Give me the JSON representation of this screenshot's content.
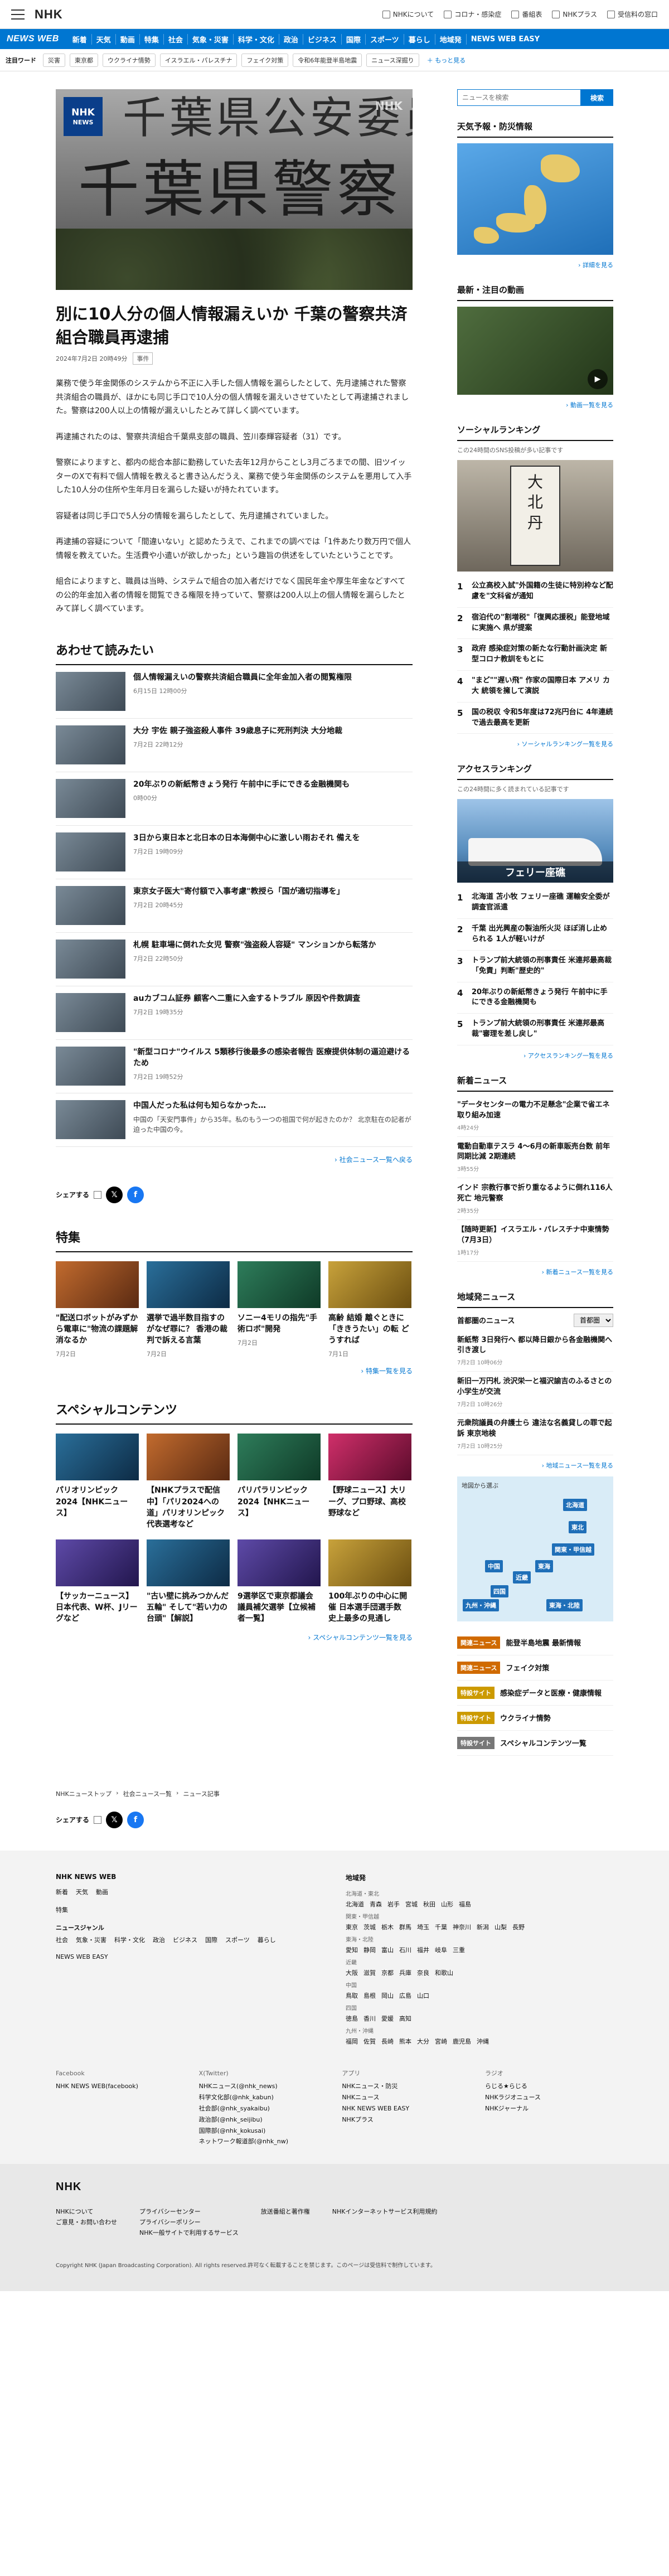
{
  "header": {
    "logo": "NHK",
    "links": [
      "NHKについて",
      "コロナ・感染症",
      "番組表",
      "NHKプラス",
      "受信料の窓口"
    ]
  },
  "nav": {
    "brand": "NEWS WEB",
    "items": [
      "新着",
      "天気",
      "動画",
      "特集",
      "社会",
      "気象・災害",
      "科学・文化",
      "政治",
      "ビジネス",
      "国際",
      "スポーツ",
      "暮らし",
      "地域発",
      "NEWS WEB EASY"
    ]
  },
  "keywords": {
    "label": "注目ワード",
    "tags": [
      "災害",
      "東京都",
      "ウクライナ情勢",
      "イスラエル・パレスチナ",
      "フェイク対策",
      "令和6年能登半島地震",
      "ニュース深掘り"
    ],
    "more": "もっと見る"
  },
  "article": {
    "hero_plate_top": "千葉県公安委員会",
    "hero_plate_bottom": "千葉県警察",
    "badge_line1": "NHK",
    "badge_line2": "NEWS",
    "watermark": "NHK",
    "title": "別に10人分の個人情報漏えいか 千葉の警察共済組合職員再逮捕",
    "date": "2024年7月2日 20時49分",
    "category": "事件",
    "paragraphs": [
      "業務で使う年金関係のシステムから不正に入手した個人情報を漏らしたとして、先月逮捕された警察共済組合の職員が、ほかにも同じ手口で10人分の個人情報を漏えいさせていたとして再逮捕されました。警察は200人以上の情報が漏えいしたとみて詳しく調べています。",
      "再逮捕されたのは、警察共済組合千葉県支部の職員、笠川泰輝容疑者（31）です。",
      "警察によりますと、都内の総合本部に勤務していた去年12月からことし3月ごろまでの間、旧ツイッターのXで有料で個人情報を教えると書き込んだうえ、業務で使う年金関係のシステムを悪用して入手した10人分の住所や生年月日を漏らした疑いが持たれています。",
      "容疑者は同じ手口で5人分の情報を漏らしたとして、先月逮捕されていました。",
      "再逮捕の容疑について「間違いない」と認めたうえで、これまでの調べでは「1件あたり数万円で個人情報を教えていた。生活費や小遣いが欲しかった」という趣旨の供述をしていたということです。",
      "組合によりますと、職員は当時、システムで組合の加入者だけでなく国民年金や厚生年金などすべての公的年金加入者の情報を閲覧できる権限を持っていて、警察は200人以上の個人情報を漏らしたとみて詳しく調べています。"
    ]
  },
  "related": {
    "heading": "あわせて読みたい",
    "items": [
      {
        "title": "個人情報漏えいの警察共済組合職員に全年金加入者の閲覧権限",
        "date": "6月15日 12時00分",
        "thumb": "#4a5560",
        "text": ""
      },
      {
        "title": "大分 宇佐 親子強盗殺人事件 39歳息子に死刑判決 大分地裁",
        "date": "7月2日 22時12分",
        "thumb": "#5a6a52",
        "text": ""
      },
      {
        "title": "20年ぶりの新紙幣きょう発行 午前中に手にできる金融機関も",
        "date": "0時00分",
        "thumb": "#2f5f9e",
        "text": ""
      },
      {
        "title": "3日から東日本と北日本の日本海側中心に激しい雨おそれ 備えを",
        "date": "7月2日 19時09分",
        "thumb": "#6b7b8c",
        "text": ""
      },
      {
        "title": "東京女子医大\"寄付額で入事考慮\"教授ら「国が適切指導を」",
        "date": "7月2日 20時45分",
        "thumb": "#7b6a5a",
        "text": ""
      },
      {
        "title": "札幌 駐車場に倒れた女児 警察\"強盗殺人容疑\" マンションから転落か",
        "date": "7月2日 22時50分",
        "thumb": "#556677",
        "text": ""
      },
      {
        "title": "auカブコム証券 顧客へ二重に入金するトラブル 原因や件数調査",
        "date": "7月2日 19時35分",
        "thumb": "#e35b1b",
        "text": ""
      },
      {
        "title": "\"新型コロナ\"ウイルス 5類移行後最多の感染者報告 医療提供体制の逼迫避けるため",
        "date": "7月2日 19時52分",
        "thumb": "#3e5a3a",
        "text": ""
      },
      {
        "title": "中国人だった私は何も知らなかった…",
        "date": "",
        "thumb": "#8a6a55",
        "text": "中国の「天安門事件」から35年。私のもう一つの祖国で何が起きたのか？ 北京駐在の記者が迫った中国の今。"
      }
    ],
    "more": "社会ニュース一覧へ戻る"
  },
  "share": {
    "label": "シェアする"
  },
  "features": {
    "heading": "特集",
    "items": [
      {
        "title": "\"配送ロボットがみずから電車に\"物流の課題解消なるか",
        "date": "7月2日"
      },
      {
        "title": "選挙で過半数目指すのがなぜ罪に？ 香港の裁判で訴える言葉",
        "date": "7月2日"
      },
      {
        "title": "ソニー4モリの指先\"手術ロボ\"開発",
        "date": "7月2日"
      },
      {
        "title": "高齢 結婚 離ぐときに「ききうたい」の転 どうすれば",
        "date": "7月1日"
      }
    ],
    "more": "特集一覧を見る"
  },
  "special": {
    "heading": "スペシャルコンテンツ",
    "items": [
      {
        "title": "パリオリンピック2024【NHKニュース】"
      },
      {
        "title": "【NHKプラスで配信中】「パリ2024への道」パリオリンピック代表選考など"
      },
      {
        "title": "パリパラリンピック2024【NHKニュース】"
      },
      {
        "title": "【野球ニュース】大リーグ、プロ野球、高校野球など"
      },
      {
        "title": "【サッカーニュース】日本代表、W杯、Jリーグなど"
      },
      {
        "title": "\"古い壁に挑みつかんだ五輪\" そして\"若い力の台頭\"【解説】"
      },
      {
        "title": "9選挙区で東京都議会議員補欠選挙【立候補者一覧】"
      },
      {
        "title": "100年ぶりの中心に開催 日本選手団選手数 史上最多の見通し"
      }
    ],
    "more": "スペシャルコンテンツ一覧を見る"
  },
  "sidebar": {
    "search_placeholder": "ニュースを検索",
    "search_button": "検索",
    "weather_heading": "天気予報・防災情報",
    "weather_more": "詳細を見る",
    "video_heading": "最新・注目の動画",
    "video_more": "動画一覧を見る",
    "social_heading": "ソーシャルランキング",
    "social_desc": "この24時間のSNS投稿が多い記事です",
    "social_items": [
      "公立高校入試\"外国籍の生徒に特別枠など配慮を\"文科省が通知",
      "宿泊代の\"割増税\"「復興応援税」能登地域に実施へ 県が提案",
      "政府 感染症対策の新たな行動計画決定 新型コロナ教訓をもとに",
      "\"まど\"\"遅い飛\" 作家の国際日本 アメリ カ大 統領を擁して演説",
      "国の税収 令和5年度は72兆円台に 4年連続で過去最高を更新"
    ],
    "social_more": "ソーシャルランキング一覧を見る",
    "access_heading": "アクセスランキング",
    "access_desc": "この24時間に多く読まれている記事です",
    "access_caption": "フェリー座礁",
    "access_items": [
      "北海道 苫小牧 フェリー座礁 運輸安全委が調査官派遣",
      "千葉 出光興産の製油所火災 ほぼ消し止められる 1人が軽いけが",
      "トランプ前大統領の刑事責任 米連邦最高裁「免責」判断\"歴史的\"",
      "20年ぶりの新紙幣きょう発行 午前中に手にできる金融機関も",
      "トランプ前大統領の刑事責任 米連邦最高裁\"審理を差し戻し\""
    ],
    "access_more": "アクセスランキング一覧を見る",
    "new_heading": "新着ニュース",
    "new_items": [
      {
        "title": "\"データセンターの電力不足懸念\"企業で省エネ取り組み加速",
        "date": "4時24分"
      },
      {
        "title": "電動自動車テスラ 4～6月の新車販売台数 前年同期比減 2期連続",
        "date": "3時55分"
      },
      {
        "title": "インド 宗教行事で折り重なるように倒れ116人死亡 地元警察",
        "date": "2時35分"
      },
      {
        "title": "【随時更新】イスラエル・パレスチナ中東情勢（7月3日）",
        "date": "1時17分"
      }
    ],
    "new_more": "新着ニュース一覧を見る",
    "local_heading": "地域発ニュース",
    "local_select_label": "首都圏のニュース",
    "local_select_value": "首都圏",
    "local_items": [
      {
        "title": "新紙幣 3日発行へ 都以降日銀から各金融機関へ引き渡し",
        "date": "7月2日 10時06分"
      },
      {
        "title": "新旧一万円札 渋沢栄一と福沢諭吉のふるさとの小学生が交流",
        "date": "7月2日 10時26分"
      },
      {
        "title": "元衆院議員の弁護士ら 違法な名義貸しの罪で起訴 東京地検",
        "date": "7月2日 10時25分"
      }
    ],
    "local_more": "地域ニュース一覧を見る",
    "map_title": "地図から選ぶ",
    "regions": [
      "北海道",
      "東北",
      "関東・甲信越",
      "東海",
      "近畿",
      "中国",
      "四国",
      "九州・沖縄",
      "東海・北陸"
    ],
    "banners": [
      {
        "tag": "関連ニュース",
        "color": "#d06a00",
        "title": "能登半島地震 最新情報"
      },
      {
        "tag": "関連ニュース",
        "color": "#d06a00",
        "title": "フェイク対策"
      },
      {
        "tag": "特設サイト",
        "color": "#cc9a00",
        "title": "感染症データと医療・健康情報"
      },
      {
        "tag": "特設サイト",
        "color": "#cc9a00",
        "title": "ウクライナ情勢"
      },
      {
        "tag": "特設サイト",
        "color": "#777777",
        "title": "スペシャルコンテンツ一覧"
      }
    ]
  },
  "breadcrumb": [
    "NHKニューストップ",
    "社会ニュース一覧",
    "ニュース記事"
  ],
  "footer": {
    "brand": "NHK NEWS WEB",
    "groups": [
      {
        "title": "",
        "links": [
          "新着",
          "天気",
          "動画"
        ]
      },
      {
        "title": "",
        "links": [
          "特集"
        ]
      },
      {
        "title": "ニュースジャンル",
        "links": [
          "社会",
          "気象・災害",
          "科学・文化",
          "政治",
          "ビジネス",
          "国際",
          "スポーツ",
          "暮らし"
        ]
      },
      {
        "title": "",
        "links": [
          "NEWS WEB EASY"
        ]
      }
    ],
    "region_title": "地域発",
    "regions": [
      {
        "area": "北海道・東北",
        "prefs": [
          "北海道",
          "青森",
          "岩手",
          "宮城",
          "秋田",
          "山形",
          "福島"
        ]
      },
      {
        "area": "関東・甲信越",
        "prefs": [
          "東京",
          "茨城",
          "栃木",
          "群馬",
          "埼玉",
          "千葉",
          "神奈川",
          "新潟",
          "山梨",
          "長野"
        ]
      },
      {
        "area": "東海・北陸",
        "prefs": [
          "愛知",
          "静岡",
          "富山",
          "石川",
          "福井",
          "岐阜",
          "三重"
        ]
      },
      {
        "area": "近畿",
        "prefs": [
          "大阪",
          "滋賀",
          "京都",
          "兵庫",
          "奈良",
          "和歌山"
        ]
      },
      {
        "area": "中国",
        "prefs": [
          "鳥取",
          "島根",
          "岡山",
          "広島",
          "山口"
        ]
      },
      {
        "area": "四国",
        "prefs": [
          "徳島",
          "香川",
          "愛媛",
          "高知"
        ]
      },
      {
        "area": "九州・沖縄",
        "prefs": [
          "福岡",
          "佐賀",
          "長崎",
          "熊本",
          "大分",
          "宮崎",
          "鹿児島",
          "沖縄"
        ]
      }
    ],
    "social": [
      {
        "title": "Facebook",
        "lines": [
          "NHK NEWS WEB(facebook)"
        ]
      },
      {
        "title": "X(Twitter)",
        "lines": [
          "NHKニュース(@nhk_news)",
          "科学文化部(@nhk_kabun)",
          "社会部(@nhk_syakaibu)",
          "政治部(@nhk_seijibu)",
          "国際部(@nhk_kokusai)",
          "ネットワーク報道部(@nhk_nw)"
        ]
      },
      {
        "title": "アプリ",
        "lines": [
          "NHKニュース・防災",
          "NHKニュース",
          "NHK NEWS WEB EASY",
          "NHKプラス"
        ]
      },
      {
        "title": "ラジオ",
        "lines": [
          "らじる★らじる",
          "NHKラジオニュース",
          "NHKジャーナル"
        ]
      }
    ]
  },
  "bottom": {
    "logo": "NHK",
    "links": [
      "NHKについて",
      "ご意見・お問い合わせ",
      "プライバシーセンター",
      "プライバシーポリシー",
      "NHK一般サイトで利用するサービス",
      "放送番組と著作権",
      "NHKインターネットサービス利用規約"
    ],
    "copyright": "Copyright NHK (Japan Broadcasting Corporation). All rights reserved.許可なく転載することを禁じます。このページは受信料で制作しています。"
  }
}
